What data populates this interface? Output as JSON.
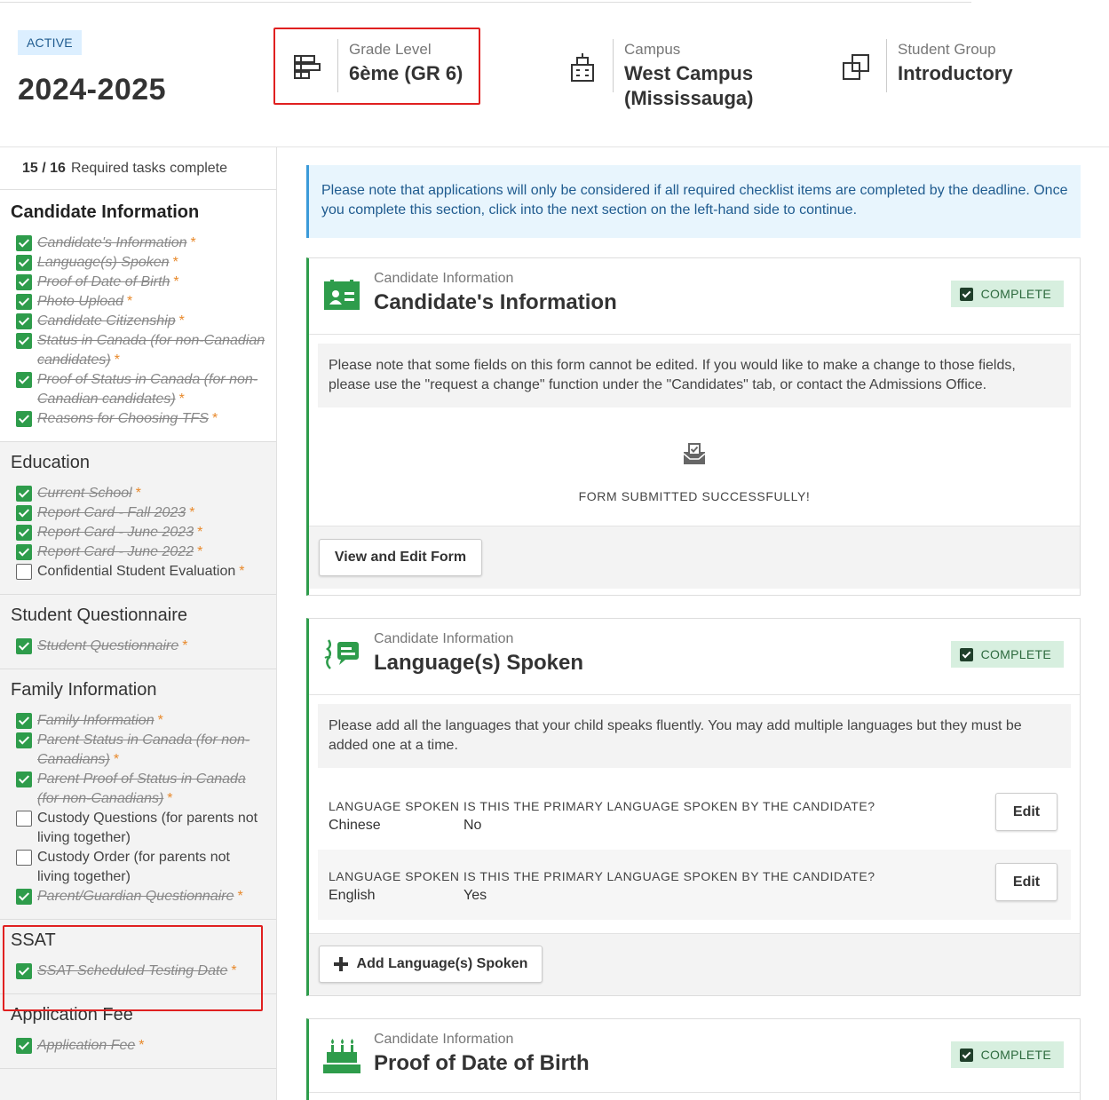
{
  "header": {
    "status": "ACTIVE",
    "year": "2024-2025",
    "grade": {
      "label": "Grade Level",
      "value": "6ème (GR 6)"
    },
    "campus": {
      "label": "Campus",
      "value_line1": "West Campus",
      "value_line2": "(Mississauga)"
    },
    "group": {
      "label": "Student Group",
      "value": "Introductory"
    }
  },
  "sidebar": {
    "progress_count": "15 / 16",
    "progress_text": "Required tasks complete",
    "sections": [
      {
        "title": "Candidate Information",
        "tasks": [
          {
            "label": "Candidate's Information",
            "done": true
          },
          {
            "label": "Language(s) Spoken",
            "done": true
          },
          {
            "label": "Proof of Date of Birth",
            "done": true
          },
          {
            "label": "Photo Upload",
            "done": true
          },
          {
            "label": "Candidate Citizenship",
            "done": true
          },
          {
            "label": "Status in Canada (for non-Canadian candidates)",
            "done": true
          },
          {
            "label": "Proof of Status in Canada (for non-Canadian candidates)",
            "done": true
          },
          {
            "label": "Reasons for Choosing TFS",
            "done": true
          }
        ]
      },
      {
        "title": "Education",
        "tasks": [
          {
            "label": "Current School",
            "done": true
          },
          {
            "label": "Report Card - Fall 2023",
            "done": true
          },
          {
            "label": "Report Card - June 2023",
            "done": true
          },
          {
            "label": "Report Card - June 2022",
            "done": true
          },
          {
            "label": "Confidential Student Evaluation",
            "done": false
          }
        ]
      },
      {
        "title": "Student Questionnaire",
        "tasks": [
          {
            "label": "Student Questionnaire",
            "done": true
          }
        ]
      },
      {
        "title": "Family Information",
        "tasks": [
          {
            "label": "Family Information",
            "done": true
          },
          {
            "label": "Parent Status in Canada (for non-Canadians)",
            "done": true
          },
          {
            "label": "Parent Proof of Status in Canada (for non-Canadians)",
            "done": true
          },
          {
            "label": "Custody Questions (for parents not living together)",
            "done": false,
            "optional": true
          },
          {
            "label": "Custody Order (for parents not living together)",
            "done": false,
            "optional": true
          },
          {
            "label": "Parent/Guardian Questionnaire",
            "done": true
          }
        ]
      },
      {
        "title": "SSAT",
        "tasks": [
          {
            "label": "SSAT Scheduled Testing Date",
            "done": true
          }
        ]
      },
      {
        "title": "Application Fee",
        "tasks": [
          {
            "label": "Application Fee",
            "done": true
          }
        ]
      }
    ]
  },
  "notice": "Please note that applications will only be considered if all required checklist items are completed by the deadline. Once you complete this section, click into the next section on the left-hand side to continue.",
  "cards": {
    "info": {
      "subtitle": "Candidate Information",
      "title": "Candidate's Information",
      "badge": "COMPLETE",
      "note": "Please note that some fields on this form cannot be edited. If you would like to make a change to those fields, please use the \"request a change\" function under the \"Candidates\" tab, or contact the Admissions Office.",
      "success": "FORM SUBMITTED SUCCESSFULLY!",
      "button": "View and Edit Form"
    },
    "lang": {
      "subtitle": "Candidate Information",
      "title": "Language(s) Spoken",
      "badge": "COMPLETE",
      "note": "Please add all the languages that your child speaks fluently. You may add multiple languages but they must be added one at a time.",
      "col1": "LANGUAGE SPOKEN",
      "col2": "IS THIS THE PRIMARY LANGUAGE SPOKEN BY THE CANDIDATE?",
      "rows": [
        {
          "language": "Chinese",
          "primary": "No",
          "action": "Edit"
        },
        {
          "language": "English",
          "primary": "Yes",
          "action": "Edit"
        }
      ],
      "add_button": "Add Language(s) Spoken"
    },
    "dob": {
      "subtitle": "Candidate Information",
      "title": "Proof of Date of Birth",
      "badge": "COMPLETE"
    }
  },
  "colors": {
    "accent_green": "#2e9c4b",
    "required_orange": "#e8892b",
    "notice_blue": "#1f5b8f",
    "highlight_red": "#e02020"
  },
  "icons": {
    "grade": "grade-level-icon",
    "campus": "building-icon",
    "group": "group-icon",
    "info": "id-card-icon",
    "lang": "speech-icon",
    "dob": "birthday-cake-icon",
    "success": "inbox-check-icon",
    "add": "plus-icon"
  }
}
